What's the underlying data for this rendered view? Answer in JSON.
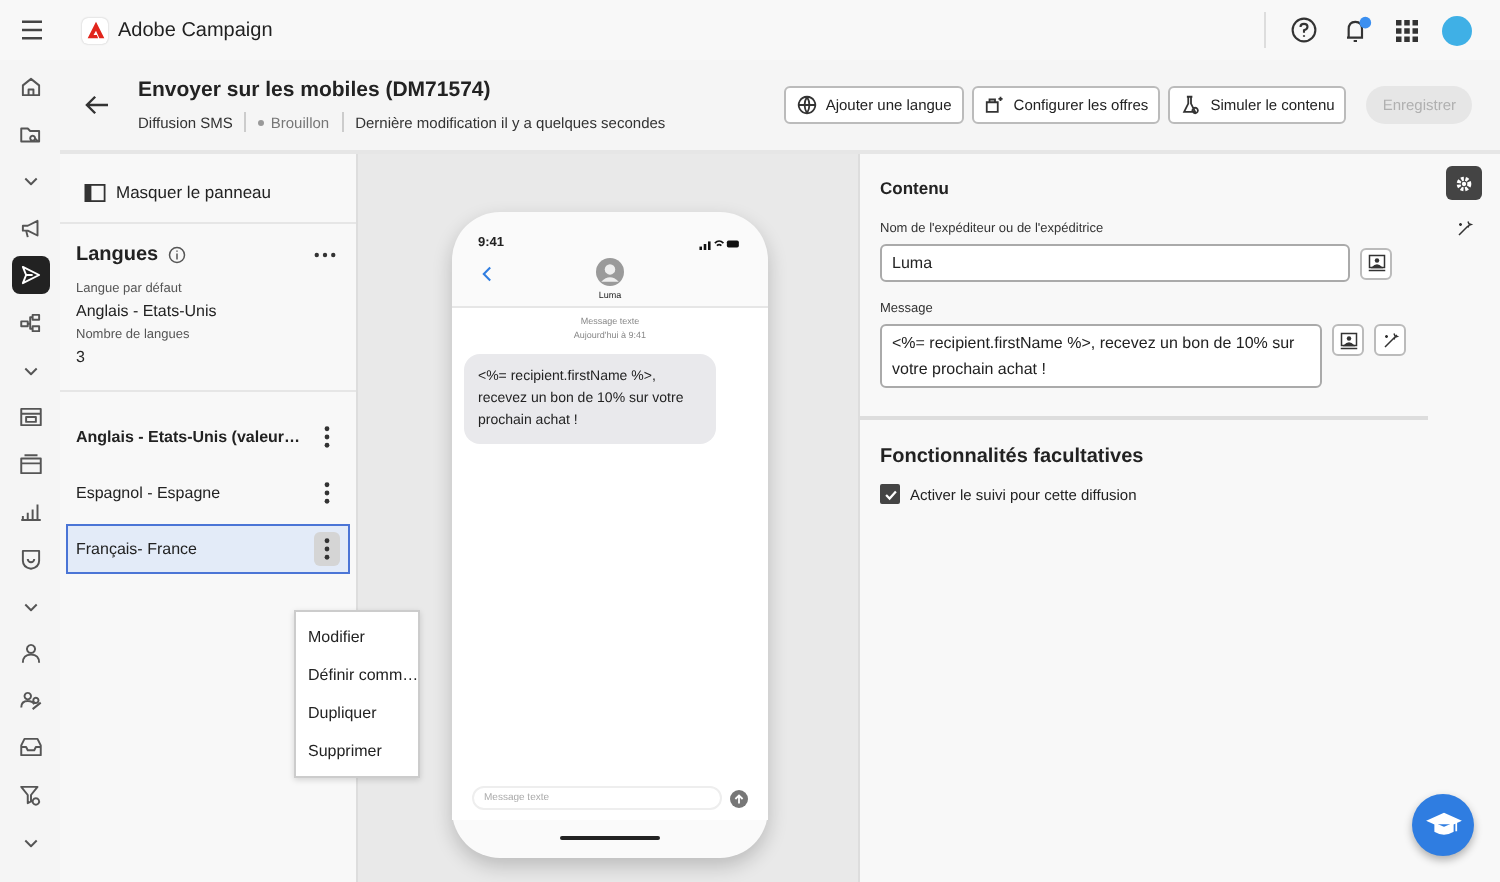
{
  "app": {
    "name": "Adobe Campaign"
  },
  "nav_rail": [
    {
      "kind": "home",
      "selected": false
    },
    {
      "kind": "folder",
      "selected": false
    },
    {
      "kind": "chevron",
      "selected": false
    },
    {
      "kind": "megaphone",
      "selected": false
    },
    {
      "kind": "send",
      "selected": true
    },
    {
      "kind": "hierarchy",
      "selected": false
    },
    {
      "kind": "chevron",
      "selected": false
    },
    {
      "kind": "calendar",
      "selected": false
    },
    {
      "kind": "cards",
      "selected": false
    },
    {
      "kind": "chart",
      "selected": false
    },
    {
      "kind": "shield",
      "selected": false
    },
    {
      "kind": "chevron",
      "selected": false
    },
    {
      "kind": "person",
      "selected": false
    },
    {
      "kind": "people",
      "selected": false
    },
    {
      "kind": "inbox",
      "selected": false
    },
    {
      "kind": "filter",
      "selected": false
    },
    {
      "kind": "chevron",
      "selected": false
    }
  ],
  "header": {
    "title": "Envoyer sur les mobiles (DM71574)",
    "channel": "Diffusion SMS",
    "status": "Brouillon",
    "modified": "Dernière modification il y a quelques secondes"
  },
  "toolbar_buttons": [
    {
      "label": "Ajouter une langue",
      "kind": "globe",
      "disabled": false
    },
    {
      "label": "Configurer les offres",
      "kind": "offers",
      "disabled": false
    },
    {
      "label": "Simuler le contenu",
      "kind": "flask",
      "disabled": false
    },
    {
      "label": "Enregistrer",
      "kind": "primary",
      "disabled": true
    }
  ],
  "left_panel": {
    "toggle": "Masquer le panneau",
    "title": "Langues",
    "default_label": "Langue par défaut",
    "default_value": "Anglais - Etats-Unis",
    "count_label": "Nombre de langues",
    "count_value": "3",
    "languages": [
      {
        "label": "Anglais - Etats-Unis (valeur…",
        "default": true,
        "selected": false
      },
      {
        "label": "Espagnol - Espagne",
        "default": false,
        "selected": false
      },
      {
        "label": "Français- France",
        "default": false,
        "selected": true
      }
    ]
  },
  "context_menu": [
    "Modifier",
    "Définir comm…",
    "Dupliquer",
    "Supprimer"
  ],
  "preview": {
    "time": "9:41",
    "contact": "Luma",
    "thread_label": "Message texte",
    "thread_date": "Aujourd'hui à 9:41",
    "message": "<%= recipient.firstName %>, recevez un bon de 10% sur votre prochain achat !",
    "input_placeholder": "Message texte"
  },
  "content": {
    "title": "Contenu",
    "sender_label": "Nom de l'expéditeur ou de l'expéditrice",
    "sender_value": "Luma",
    "message_label": "Message",
    "message_value": "<%= recipient.firstName %>, recevez un bon de 10% sur votre prochain achat !"
  },
  "options": {
    "title": "Fonctionnalités facultatives",
    "items": [
      {
        "label": "Activer le suivi pour cette diffusion",
        "checked": true
      }
    ]
  },
  "side_tabs": [
    {
      "kind": "settings",
      "selected": true
    },
    {
      "kind": "sparkle",
      "selected": false
    }
  ]
}
